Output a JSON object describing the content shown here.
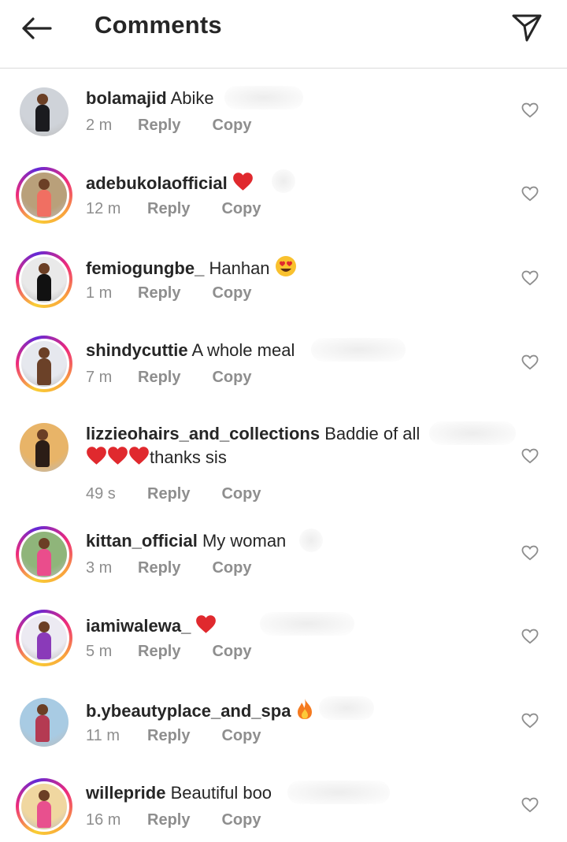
{
  "header": {
    "title": "Comments",
    "back_icon": "arrow-left-icon",
    "share_icon": "paper-plane-icon"
  },
  "colors": {
    "text": "#262626",
    "meta": "#8e8e8e",
    "heart_red": "#e0292e",
    "divider": "#dbdbdb"
  },
  "comments": [
    {
      "username": "bolamajid",
      "text": "Abike",
      "emojis": [],
      "time": "2 m",
      "reply": "Reply",
      "copy": "Copy",
      "story_ring": false,
      "avatar_colors": [
        "#cfd3d9",
        "#1b1b1f"
      ]
    },
    {
      "username": "adebukolaofficial",
      "text": "",
      "emojis": [
        "red-heart"
      ],
      "time": "12 m",
      "reply": "Reply",
      "copy": "Copy",
      "story_ring": true,
      "avatar_colors": [
        "#b9a07a",
        "#f06f62"
      ]
    },
    {
      "username": "femiogungbe_",
      "text": "Hanhan",
      "emojis": [
        "heart-eyes"
      ],
      "time": "1 m",
      "reply": "Reply",
      "copy": "Copy",
      "story_ring": true,
      "avatar_colors": [
        "#e9e9e9",
        "#111111"
      ]
    },
    {
      "username": "shindycuttie",
      "text": "A whole meal",
      "emojis": [],
      "time": "7 m",
      "reply": "Reply",
      "copy": "Copy",
      "story_ring": true,
      "avatar_colors": [
        "#e6e8ee",
        "#6b4128"
      ]
    },
    {
      "username": "lizzieohairs_and_collections",
      "text": "Baddie of all",
      "text_line2": "thanks sis",
      "emojis": [
        "red-heart",
        "red-heart",
        "red-heart"
      ],
      "time": "49 s",
      "reply": "Reply",
      "copy": "Copy",
      "story_ring": false,
      "avatar_colors": [
        "#e8b468",
        "#2b1d16"
      ]
    },
    {
      "username": "kittan_official",
      "text": "My woman",
      "emojis": [],
      "time": "3 m",
      "reply": "Reply",
      "copy": "Copy",
      "story_ring": true,
      "avatar_colors": [
        "#8fb57a",
        "#ea4d8c"
      ]
    },
    {
      "username": "iamiwalewa_",
      "text": "",
      "emojis": [
        "red-heart"
      ],
      "time": "5 m",
      "reply": "Reply",
      "copy": "Copy",
      "story_ring": true,
      "avatar_colors": [
        "#eceaf2",
        "#8a3ab9"
      ]
    },
    {
      "username": "b.ybeautyplace_and_spa",
      "text": "",
      "emojis": [
        "fire"
      ],
      "time": "11 m",
      "reply": "Reply",
      "copy": "Copy",
      "story_ring": false,
      "avatar_colors": [
        "#a8cbe3",
        "#b43a52"
      ]
    },
    {
      "username": "willepride",
      "text": "Beautiful boo",
      "emojis": [],
      "time": "16 m",
      "reply": "Reply",
      "copy": "Copy",
      "story_ring": true,
      "avatar_colors": [
        "#f0d7a0",
        "#e8508e"
      ]
    }
  ]
}
